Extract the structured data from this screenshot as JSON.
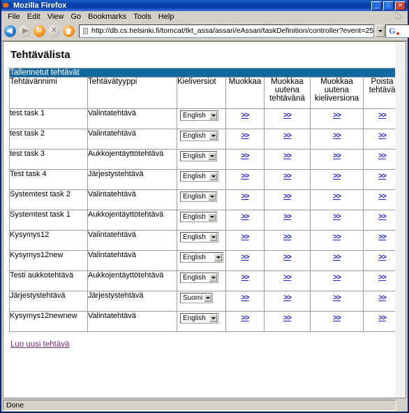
{
  "window": {
    "title": "Mozilla Firefox",
    "minimize_label": "_",
    "maximize_label": "□",
    "close_label": "✕"
  },
  "menu": {
    "items": [
      {
        "label": "File"
      },
      {
        "label": "Edit"
      },
      {
        "label": "View"
      },
      {
        "label": "Go"
      },
      {
        "label": "Bookmarks"
      },
      {
        "label": "Tools"
      },
      {
        "label": "Help"
      }
    ]
  },
  "toolbar": {
    "back_icon": "back-arrow-icon",
    "forward_icon": "forward-arrow-icon",
    "reload_icon": "reload-icon",
    "stop_icon": "stop-icon",
    "home_icon": "home-icon",
    "url": "http://db.cs.helsinki.fi/tomcat/tkt_assa/assari/eAssari/taskDefinition/controller?event=25",
    "search_engine": "G"
  },
  "page": {
    "title": "Tehtävälista",
    "table_caption": "Tallennetut tehtävät",
    "columns": [
      "Tehtävännimi",
      "Tehtävätyyppi",
      "Kieliversiot",
      "Muokkaa",
      "Muokkaa uutena tehtävänä",
      "Muokkaa uutena kieliversiona",
      "Poista tehtävä"
    ],
    "link_label": ">>",
    "rows": [
      {
        "name": "test task 1",
        "type": "Valintatehtävä",
        "language": "English",
        "select_width": 55
      },
      {
        "name": "test task 2",
        "type": "Valintatehtävä",
        "language": "English",
        "select_width": 55
      },
      {
        "name": "test task 3",
        "type": "Aukkojentäyttötehtävä",
        "language": "English",
        "select_width": 53
      },
      {
        "name": "Test task 4",
        "type": "Järjestystehtävä",
        "language": "English",
        "select_width": 55
      },
      {
        "name": "Systemtest task 2",
        "type": "Valintatehtävä",
        "language": "English",
        "select_width": 53
      },
      {
        "name": "Systemtest task 1",
        "type": "Aukkojentäyttötehtävä",
        "language": "English",
        "select_width": 53
      },
      {
        "name": "Kysymys12",
        "type": "Valintatehtävä",
        "language": "English",
        "select_width": 55
      },
      {
        "name": "Kysymys12new",
        "type": "Valintatehtävä",
        "language": "English",
        "select_width": 62
      },
      {
        "name": "Testi aukkotehtävä",
        "type": "Aukkojentäyttötehtävä",
        "language": "English",
        "select_width": 55
      },
      {
        "name": "Järjestystehtävä",
        "type": "Järjestystehtävä",
        "language": "Suomi",
        "select_width": 47
      },
      {
        "name": "Kysymys12newnew",
        "type": "Valintatehtävä",
        "language": "English",
        "select_width": 55
      }
    ],
    "new_task_link": "Luo uusi tehtävä"
  },
  "statusbar": {
    "text": "Done"
  },
  "colors": {
    "header_blue": "#11689f",
    "link_blue": "#2222cc",
    "visited_purple": "#7a2a7a",
    "chrome_grey": "#d4d0c8"
  }
}
